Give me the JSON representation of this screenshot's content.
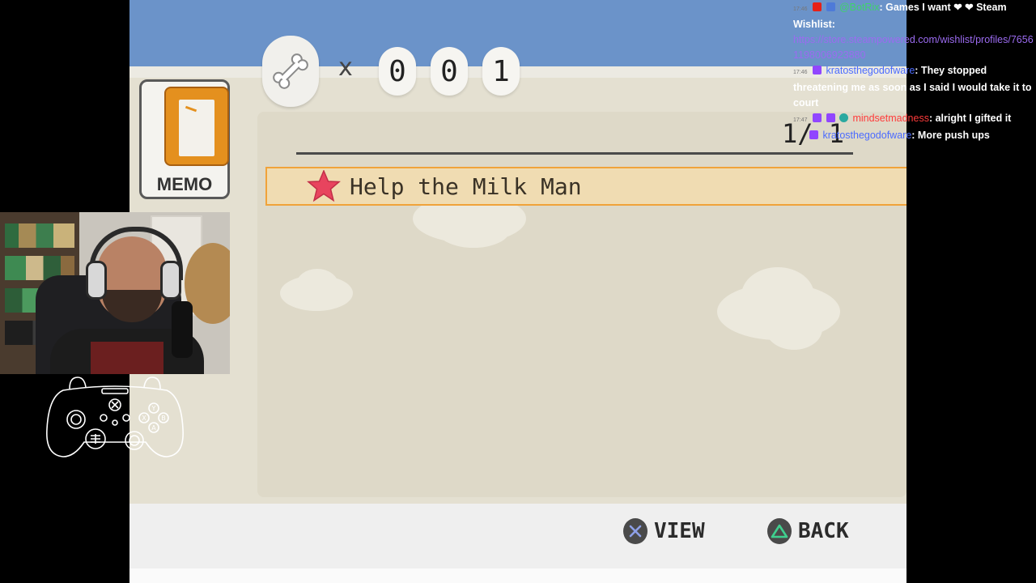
{
  "hud": {
    "item_icon": "bone-icon",
    "multiply_sign": "x",
    "digits": [
      "0",
      "0",
      "1"
    ]
  },
  "memo_tab": {
    "label": "MEMO",
    "icon": "book-icon",
    "color": "#e4901e"
  },
  "page_counter": "1/ 1",
  "memo_list": [
    {
      "label": "Help the Milk Man",
      "icon": "star-icon",
      "icon_color": "#e8445e"
    }
  ],
  "button_hints": [
    {
      "button": "cross-button-icon",
      "label": "VIEW"
    },
    {
      "button": "triangle-button-icon",
      "label": "BACK"
    }
  ],
  "chat": {
    "messages": [
      {
        "time": "17:46",
        "user": "@BotRix",
        "user_color": "#3fd36b",
        "text": ": Games I want ❤ ❤ Steam Wishlist:",
        "link": "https://store.steampowered.com/wishlist/profiles/76561198006923880"
      },
      {
        "time": "17:46",
        "user": "kratosthegodofware",
        "user_color": "#4b6bff",
        "text": ": They stopped threatening me as soon as I said I would take it to court"
      },
      {
        "time": "17:47",
        "user": "mindsetmadness",
        "user_color": "#ff3b3b",
        "text": ": alright I gifted it"
      },
      {
        "time": "",
        "user": "kratosthegodofware",
        "user_color": "#4b6bff",
        "text": ": More push ups"
      }
    ]
  },
  "colors": {
    "sky": "#6b93c9",
    "panel": "#e4e0d1",
    "selection_fill": "#f0dcb2",
    "selection_border": "#f0a33a",
    "star": "#e8445e"
  }
}
